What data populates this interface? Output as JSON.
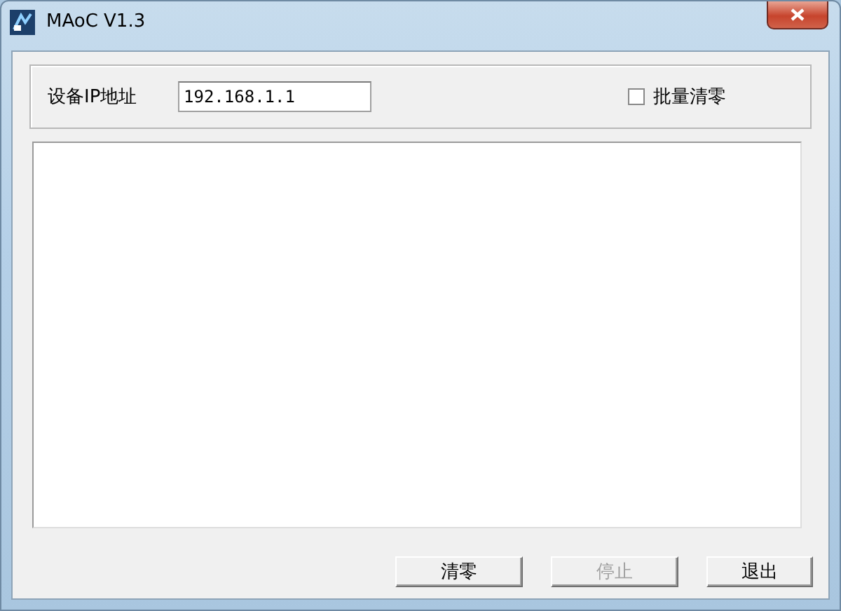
{
  "window": {
    "title": "MAoC V1.3"
  },
  "device": {
    "ip_label": "设备IP地址",
    "ip_value": "192.168.1.1",
    "batch_clear": {
      "label": "批量清零",
      "checked": false
    }
  },
  "buttons": [
    {
      "label": "清零",
      "disabled": false
    },
    {
      "label": "停止",
      "disabled": true
    },
    {
      "label": "退出",
      "disabled": false
    }
  ]
}
